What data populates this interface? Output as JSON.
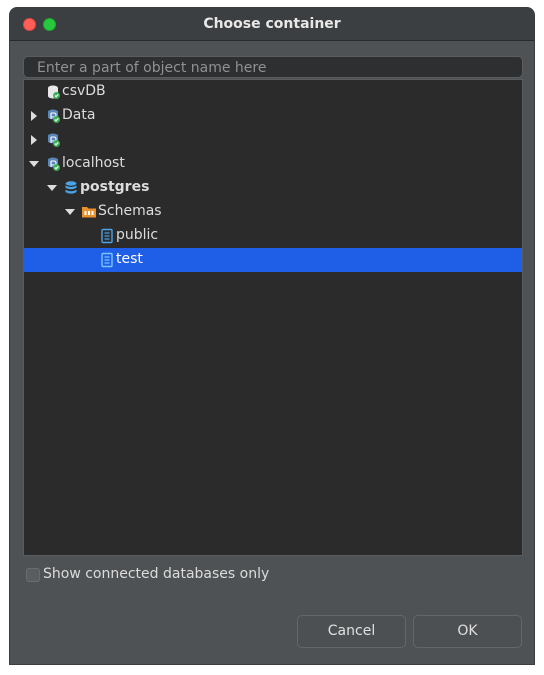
{
  "window": {
    "title": "Choose container"
  },
  "search": {
    "placeholder": "Enter a part of object name here"
  },
  "tree": {
    "items": [
      {
        "label": "csvDB",
        "icon": "database-connection-icon",
        "expand": "none"
      },
      {
        "label": "Data",
        "icon": "postgres-connection-icon",
        "expand": "collapsed"
      },
      {
        "label": "",
        "icon": "postgres-connection-icon",
        "expand": "collapsed"
      },
      {
        "label": "localhost",
        "icon": "postgres-connection-icon",
        "expand": "expanded"
      },
      {
        "label": "postgres",
        "icon": "database-icon",
        "expand": "expanded"
      },
      {
        "label": "Schemas",
        "icon": "folder-icon",
        "expand": "expanded"
      },
      {
        "label": "public",
        "icon": "schema-icon",
        "expand": "none"
      },
      {
        "label": "test",
        "icon": "schema-icon",
        "expand": "none",
        "selected": true
      }
    ]
  },
  "options": {
    "connected_only_label": "Show connected databases only"
  },
  "buttons": {
    "cancel": "Cancel",
    "ok": "OK"
  },
  "colors": {
    "selection": "#1f5fe8",
    "tree_bg": "#2b2b2b",
    "dialog_bg": "#4e5254"
  }
}
